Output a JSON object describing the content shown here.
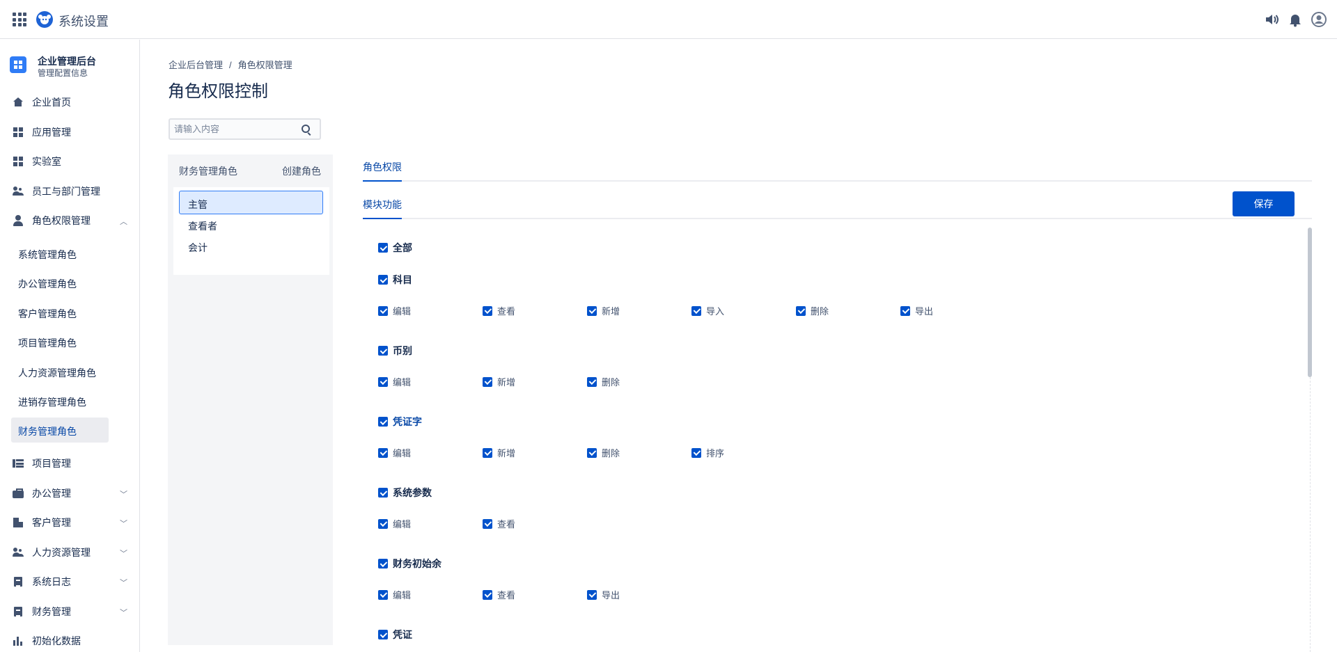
{
  "app": {
    "title": "系统设置"
  },
  "sidebar": {
    "brand_title": "企业管理后台",
    "brand_subtitle": "管理配置信息",
    "items": [
      {
        "label": "企业首页"
      },
      {
        "label": "应用管理"
      },
      {
        "label": "实验室"
      },
      {
        "label": "员工与部门管理"
      },
      {
        "label": "角色权限管理"
      },
      {
        "label": "项目管理"
      },
      {
        "label": "办公管理"
      },
      {
        "label": "客户管理"
      },
      {
        "label": "人力资源管理"
      },
      {
        "label": "系统日志"
      },
      {
        "label": "财务管理"
      },
      {
        "label": "初始化数据"
      }
    ],
    "sub_items": [
      {
        "label": "系统管理角色"
      },
      {
        "label": "办公管理角色"
      },
      {
        "label": "客户管理角色"
      },
      {
        "label": "项目管理角色"
      },
      {
        "label": "人力资源管理角色"
      },
      {
        "label": "进销存管理角色"
      },
      {
        "label": "财务管理角色"
      }
    ]
  },
  "breadcrumb": {
    "parent": "企业后台管理",
    "sep": "/",
    "current": "角色权限管理"
  },
  "page_title": "角色权限控制",
  "search": {
    "placeholder": "请输入内容"
  },
  "roles": {
    "header": "财务管理角色",
    "create": "创建角色",
    "items": [
      {
        "label": "主管"
      },
      {
        "label": "查看者"
      },
      {
        "label": "会计"
      }
    ]
  },
  "tabs": {
    "primary": "角色权限",
    "secondary": "模块功能"
  },
  "save_label": "保存",
  "permissions": {
    "all": "全部",
    "groups": [
      {
        "name": "科目",
        "options": [
          "编辑",
          "查看",
          "新增",
          "导入",
          "删除",
          "导出"
        ]
      },
      {
        "name": "币别",
        "options": [
          "编辑",
          "新增",
          "删除"
        ]
      },
      {
        "name": "凭证字",
        "options": [
          "编辑",
          "新增",
          "删除",
          "排序"
        ]
      },
      {
        "name": "系统参数",
        "options": [
          "编辑",
          "查看"
        ]
      },
      {
        "name": "财务初始余",
        "options": [
          "编辑",
          "查看",
          "导出"
        ]
      },
      {
        "name": "凭证",
        "options": []
      }
    ]
  },
  "colors": {
    "accent": "#0052cc",
    "selected_bg": "#deebff",
    "text": "#172b4d"
  }
}
